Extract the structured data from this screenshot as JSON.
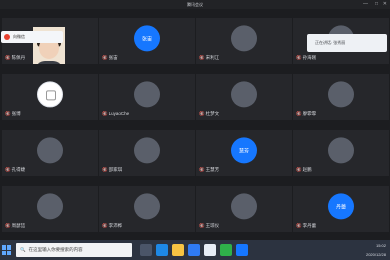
{
  "window_title": "腾讯会议",
  "wechat_notice": "向微信",
  "panel_text": "正在讲话: 张秀丽",
  "participants": [
    {
      "name": "陈佩丹",
      "row": 0,
      "col": 0,
      "type": "video"
    },
    {
      "name": "张宙",
      "row": 0,
      "col": 1,
      "type": "text",
      "avatar_text": "张宙"
    },
    {
      "name": "宋利江",
      "row": 0,
      "col": 2,
      "type": "img"
    },
    {
      "name": "孙海刚",
      "row": 0,
      "col": 3,
      "type": "img"
    },
    {
      "name": "张博",
      "row": 1,
      "col": 0,
      "type": "qr"
    },
    {
      "name": "LuyaoChe",
      "row": 1,
      "col": 1,
      "type": "img"
    },
    {
      "name": "杜梦文",
      "row": 1,
      "col": 2,
      "type": "img"
    },
    {
      "name": "廖霏霏",
      "row": 1,
      "col": 3,
      "type": "img"
    },
    {
      "name": "孔得婕",
      "row": 2,
      "col": 0,
      "type": "img"
    },
    {
      "name": "邵家琪",
      "row": 2,
      "col": 1,
      "type": "img"
    },
    {
      "name": "王慧芳",
      "row": 2,
      "col": 2,
      "type": "text",
      "avatar_text": "慧芳"
    },
    {
      "name": "赵鹏",
      "row": 2,
      "col": 3,
      "type": "img"
    },
    {
      "name": "周瑟喆",
      "row": 3,
      "col": 0,
      "type": "img"
    },
    {
      "name": "李沛桦",
      "row": 3,
      "col": 1,
      "type": "img"
    },
    {
      "name": "王琼仪",
      "row": 3,
      "col": 2,
      "type": "img"
    },
    {
      "name": "李丹蕾",
      "row": 3,
      "col": 3,
      "type": "text",
      "avatar_text": "丹蕾"
    }
  ],
  "taskbar": {
    "search_placeholder": "在这里输入你要搜索的内容",
    "time": "15:02",
    "date": "2020/12/28"
  }
}
